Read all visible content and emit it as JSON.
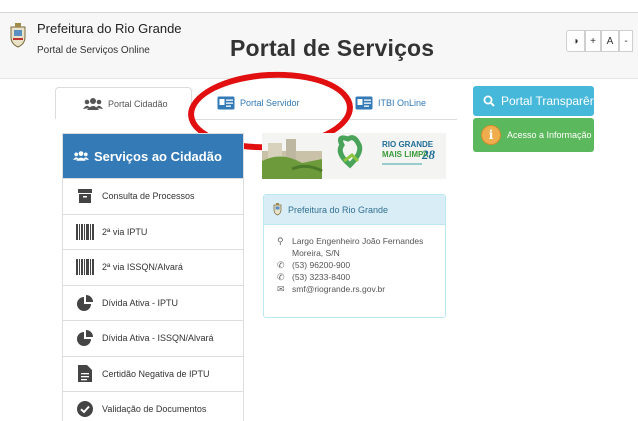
{
  "header": {
    "org_title": "Prefeitura do Rio Grande",
    "org_subtitle": "Portal de Serviços Online",
    "page_title": "Portal de Serviços",
    "accessibility": {
      "contrast": "◑",
      "increase": "+",
      "font": "A",
      "decrease": "-"
    }
  },
  "tabs": [
    {
      "label": "Portal Cidadão",
      "icon": "users-icon",
      "active": true
    },
    {
      "label": "Portal Servidor",
      "icon": "id-card-icon",
      "active": false
    },
    {
      "label": "ITBI OnLine",
      "icon": "id-card-icon",
      "active": false
    }
  ],
  "side_buttons": {
    "transparencia": "Portal Transparência",
    "acesso": "Acesso a Informação"
  },
  "services": {
    "title": "Serviços ao Cidadão",
    "items": [
      {
        "label": "Consulta de Processos",
        "icon": "archive-icon"
      },
      {
        "label": "2ª via IPTU",
        "icon": "barcode-icon"
      },
      {
        "label": "2ª via ISSQN/Alvará",
        "icon": "barcode-icon"
      },
      {
        "label": "Dívida Ativa - IPTU",
        "icon": "pie-chart-icon"
      },
      {
        "label": "Dívida Ativa - ISSQN/Alvará",
        "icon": "pie-chart-icon"
      },
      {
        "label": "Certidão Negativa de IPTU",
        "icon": "document-icon"
      },
      {
        "label": "Validação de Documentos",
        "icon": "check-circle-icon"
      }
    ]
  },
  "banner": {
    "line1": "RIO GRANDE",
    "line2": "MAIS LIMPA",
    "anniversary": "28"
  },
  "contact": {
    "title": "Prefeitura do Rio Grande",
    "address_line1": "Largo Engenheiro João Fernandes",
    "address_line2": "Moreira, S/N",
    "phone1": "(53) 96200-900",
    "phone2": "(53) 3233-8400",
    "email": "smf@riogrande.rs.gov.br"
  },
  "colors": {
    "primary": "#337ab7",
    "info": "#46b8da",
    "success": "#5cb85c",
    "annotation": "#e10f0f"
  }
}
